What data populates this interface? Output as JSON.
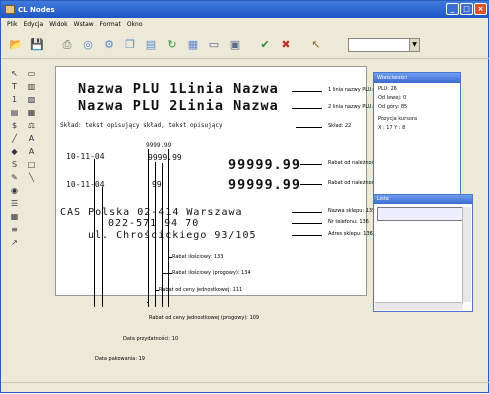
{
  "window": {
    "title": "CL Nodes"
  },
  "menu": [
    "Plik",
    "Edycja",
    "Widok",
    "Wstaw",
    "Format",
    "Okno"
  ],
  "toolbar": {
    "buttons": [
      "open-icon",
      "save-icon",
      "print-icon",
      "preview-icon",
      "settings-icon",
      "copy-icon",
      "paste-icon",
      "refresh-icon",
      "grid-icon",
      "image-icon",
      "window-icon",
      "ok-icon",
      "cancel-icon",
      "pointer-icon"
    ],
    "zoom_value": ""
  },
  "receipt": {
    "line1": "Nazwa PLU 1Linia  Nazwa",
    "line2": "Nazwa PLU 2Linia  Nazwa",
    "ingredients": "Skład: tekst opisujący skład, tekst opisujący",
    "date1": "10-11-04",
    "date2": "10-11-04",
    "val_small1": "9999.99",
    "val_small2": "9999.99",
    "val_small3": "99",
    "price1": "99999.99",
    "price2": "99999.99",
    "store1": "CAS Polska 02-414 Warszawa",
    "store2": "022-571 94 70",
    "store3": "ul. Chrościckiego 93/105"
  },
  "labels": {
    "l1": "1 linia nazwy PLU: 26",
    "l2": "2 linia nazwy PLU: 26",
    "l3": "Skład: 22",
    "l4": "Rabat od należności (progowy): 113",
    "l5": "Rabat od należności: 114",
    "l6": "Nazwa sklepu: 135",
    "l7": "Nr telefonu: 136",
    "l8": "Adres sklepu: 136",
    "b1": "Rabat ilościowy: 133",
    "b2": "Rabat ilościowy (progowy): 134",
    "b3": "Rabat od ceny jednostkowej: 111",
    "b4": "Rabat od ceny jednostkowej (progowy): 109",
    "b5": "Data przydatności: 10",
    "b6": "Data pakowania: 19"
  },
  "panel": {
    "title": "Właściwości",
    "tab": "Właściwości",
    "plu": "PLU: 26",
    "field1": "Od lewej: 0",
    "field2": "Od góry: 85",
    "pos_label": "Pozycja kursora",
    "coords": "X : 17        Y : 8"
  },
  "subpanel": {
    "title": "Lista",
    "item": ""
  }
}
